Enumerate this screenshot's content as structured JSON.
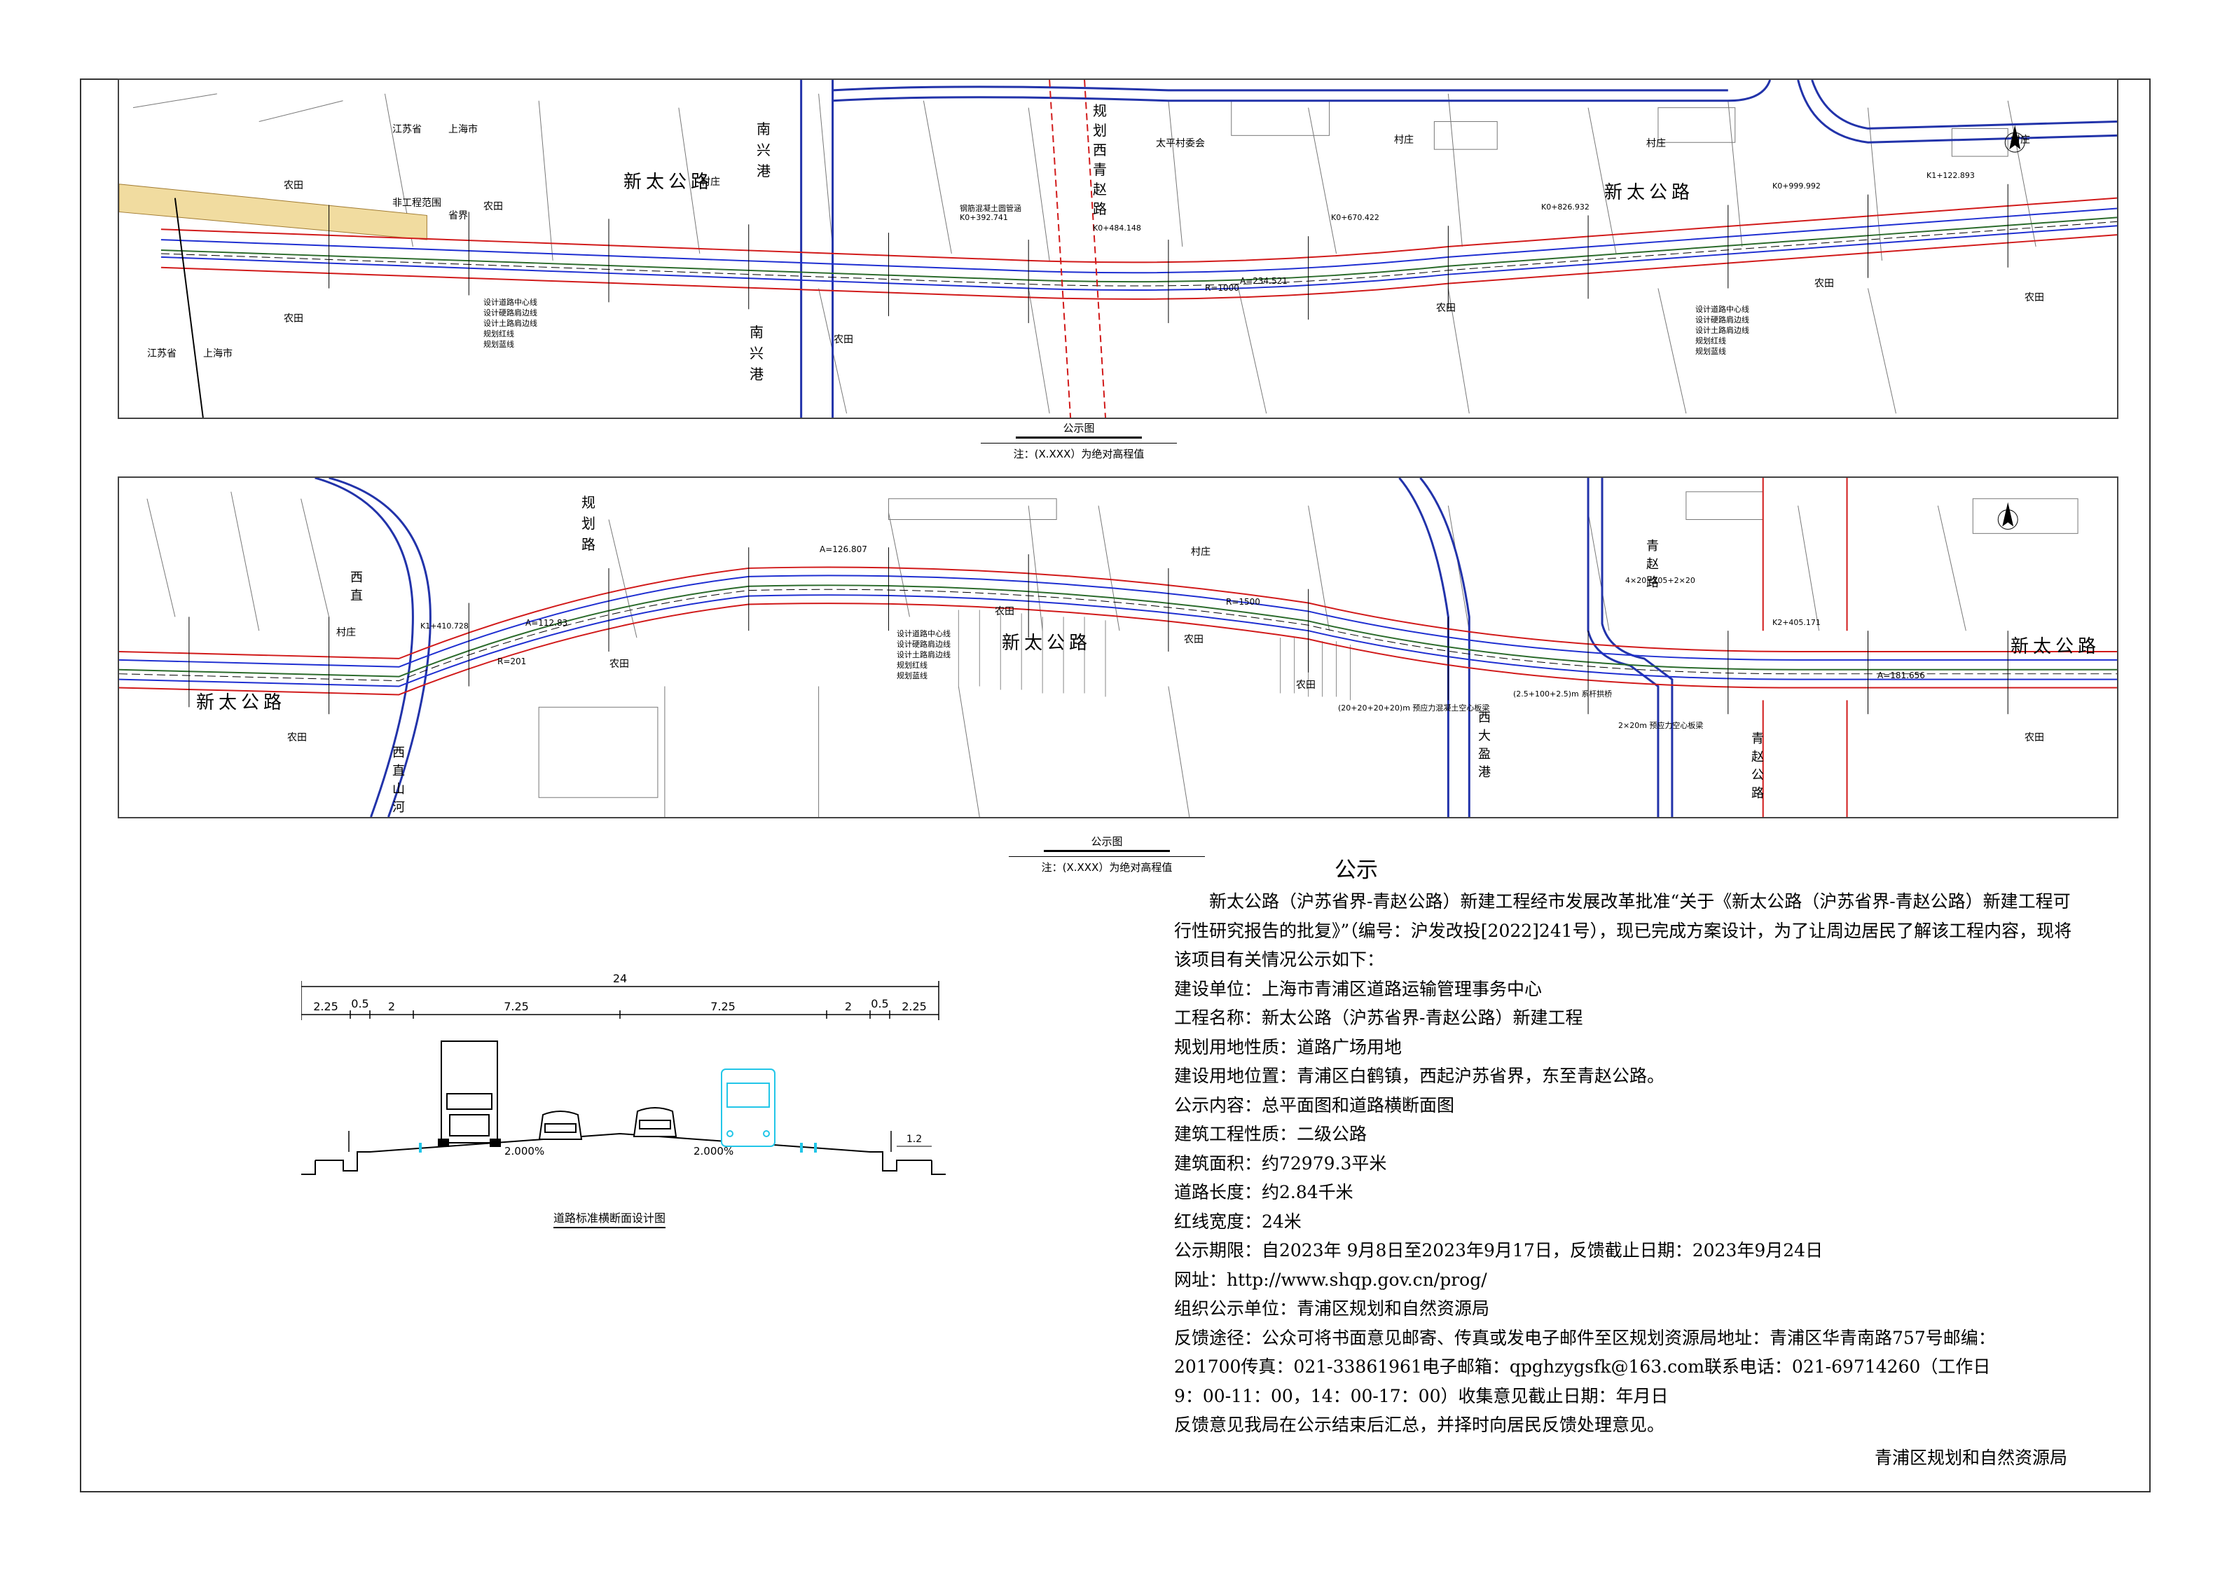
{
  "map1": {
    "road_name_1": "新太公路",
    "road_name_2": "新太公路",
    "river_1": "南兴港",
    "river_2": "南兴港",
    "planned_road": "规划西青赵路",
    "village_committee": "太平村委会",
    "province_jiangsu": "江苏省",
    "city_shanghai": "上海市",
    "province_border": "省界",
    "non_project": "非工程范围",
    "farmland": "农田",
    "village": "村庄",
    "legend": [
      "设计道路中心线",
      "设计硬路肩边线",
      "设计土路肩边线",
      "规划红线",
      "规划蓝线"
    ],
    "station_a": "A=234.521",
    "station_r": "R=1000",
    "chainage_1": "K0+392.741",
    "chainage_2": "K0+484.148",
    "chainage_3": "K0+670.422",
    "chainage_4": "K0+826.932",
    "chainage_5": "K0+999.992",
    "chainage_6": "K1+122.893",
    "pipe_note": "钢筋混凝土圆管涵"
  },
  "caption1": {
    "title": "公示图",
    "note": "注：(X.XXX）为绝对高程值"
  },
  "map2": {
    "road_name_1": "新太公路",
    "road_name_2": "新太公路",
    "road_name_3": "新太公路",
    "planned_road": "规划路",
    "west_line": "西直",
    "river_west": "西直山河",
    "river_west2": "西大盈港",
    "qingzhao_road": "青赵路",
    "qingzhao_highway": "青赵公路",
    "farmland": "农田",
    "village": "村庄",
    "legend": [
      "设计道路中心线",
      "设计硬路肩边线",
      "设计土路肩边线",
      "规划红线",
      "规划蓝线"
    ],
    "station_a1": "A=126.807",
    "station_a2": "A=112.83",
    "station_r1": "R=1500",
    "station_r2": "R=201",
    "station_a3": "A=181.656",
    "bridge_1": "(20+20+20+20)m 预应力混凝土空心板梁",
    "bridge_2": "(2.5+100+2.5)m 系杆拱桥",
    "bridge_3": "4×20+105+2×20",
    "bridge_4": "2×20m 预应力空心板梁",
    "chainage_1": "K1+410.728",
    "chainage_2": "K2+405.171"
  },
  "caption2": {
    "title": "公示图",
    "note": "注：(X.XXX）为绝对高程值"
  },
  "notice": {
    "title": "公示",
    "intro": "新太公路（沪苏省界-青赵公路）新建工程经市发展改革批准“关于《新太公路（沪苏省界-青赵公路）新建工程可行性研究报告的批复》”（编号：沪发改投[2022]241号），现已完成方案设计，为了让周边居民了解该工程内容，现将该项目有关情况公示如下：",
    "lines": [
      "建设单位：上海市青浦区道路运输管理事务中心",
      "工程名称：新太公路（沪苏省界-青赵公路）新建工程",
      "规划用地性质：道路广场用地",
      "建设用地位置：青浦区白鹤镇，西起沪苏省界，东至青赵公路。",
      "公示内容：总平面图和道路横断面图",
      "建筑工程性质：二级公路",
      "建筑面积：约72979.3平米",
      "道路长度：约2.84千米",
      "红线宽度：24米",
      "公示期限：自2023年 9月8日至2023年9月17日，反馈截止日期：2023年9月24日",
      "网址：http://www.shqp.gov.cn/prog/",
      "组织公示单位：青浦区规划和自然资源局",
      "反馈途径：公众可将书面意见邮寄、传真或发电子邮件至区规划资源局地址：青浦区华青南路757号邮编：",
      "201700传真：021-33861961电子邮箱：qpghzygsfk@163.com联系电话：021-69714260（工作日",
      "9：00-11：00，14：00-17：00）收集意见截止日期：年月日",
      "反馈意见我局在公示结束后汇总，并择时向居民反馈处理意见。"
    ],
    "signature": "青浦区规划和自然资源局"
  },
  "section": {
    "total_width": "24",
    "dims": [
      "2.25",
      "0.5",
      "2",
      "7.25",
      "7.25",
      "2",
      "0.5",
      "2.25"
    ],
    "slope_left": "2.000%",
    "slope_right": "2.000%",
    "ditch": "1.2",
    "title": "道路标准横断面设计图"
  },
  "colors": {
    "road_centerline": "#2b6b2b",
    "red_line": "#d11a1a",
    "blue_line": "#1f2fd1",
    "river": "#2233aa",
    "grid": "#444444"
  }
}
